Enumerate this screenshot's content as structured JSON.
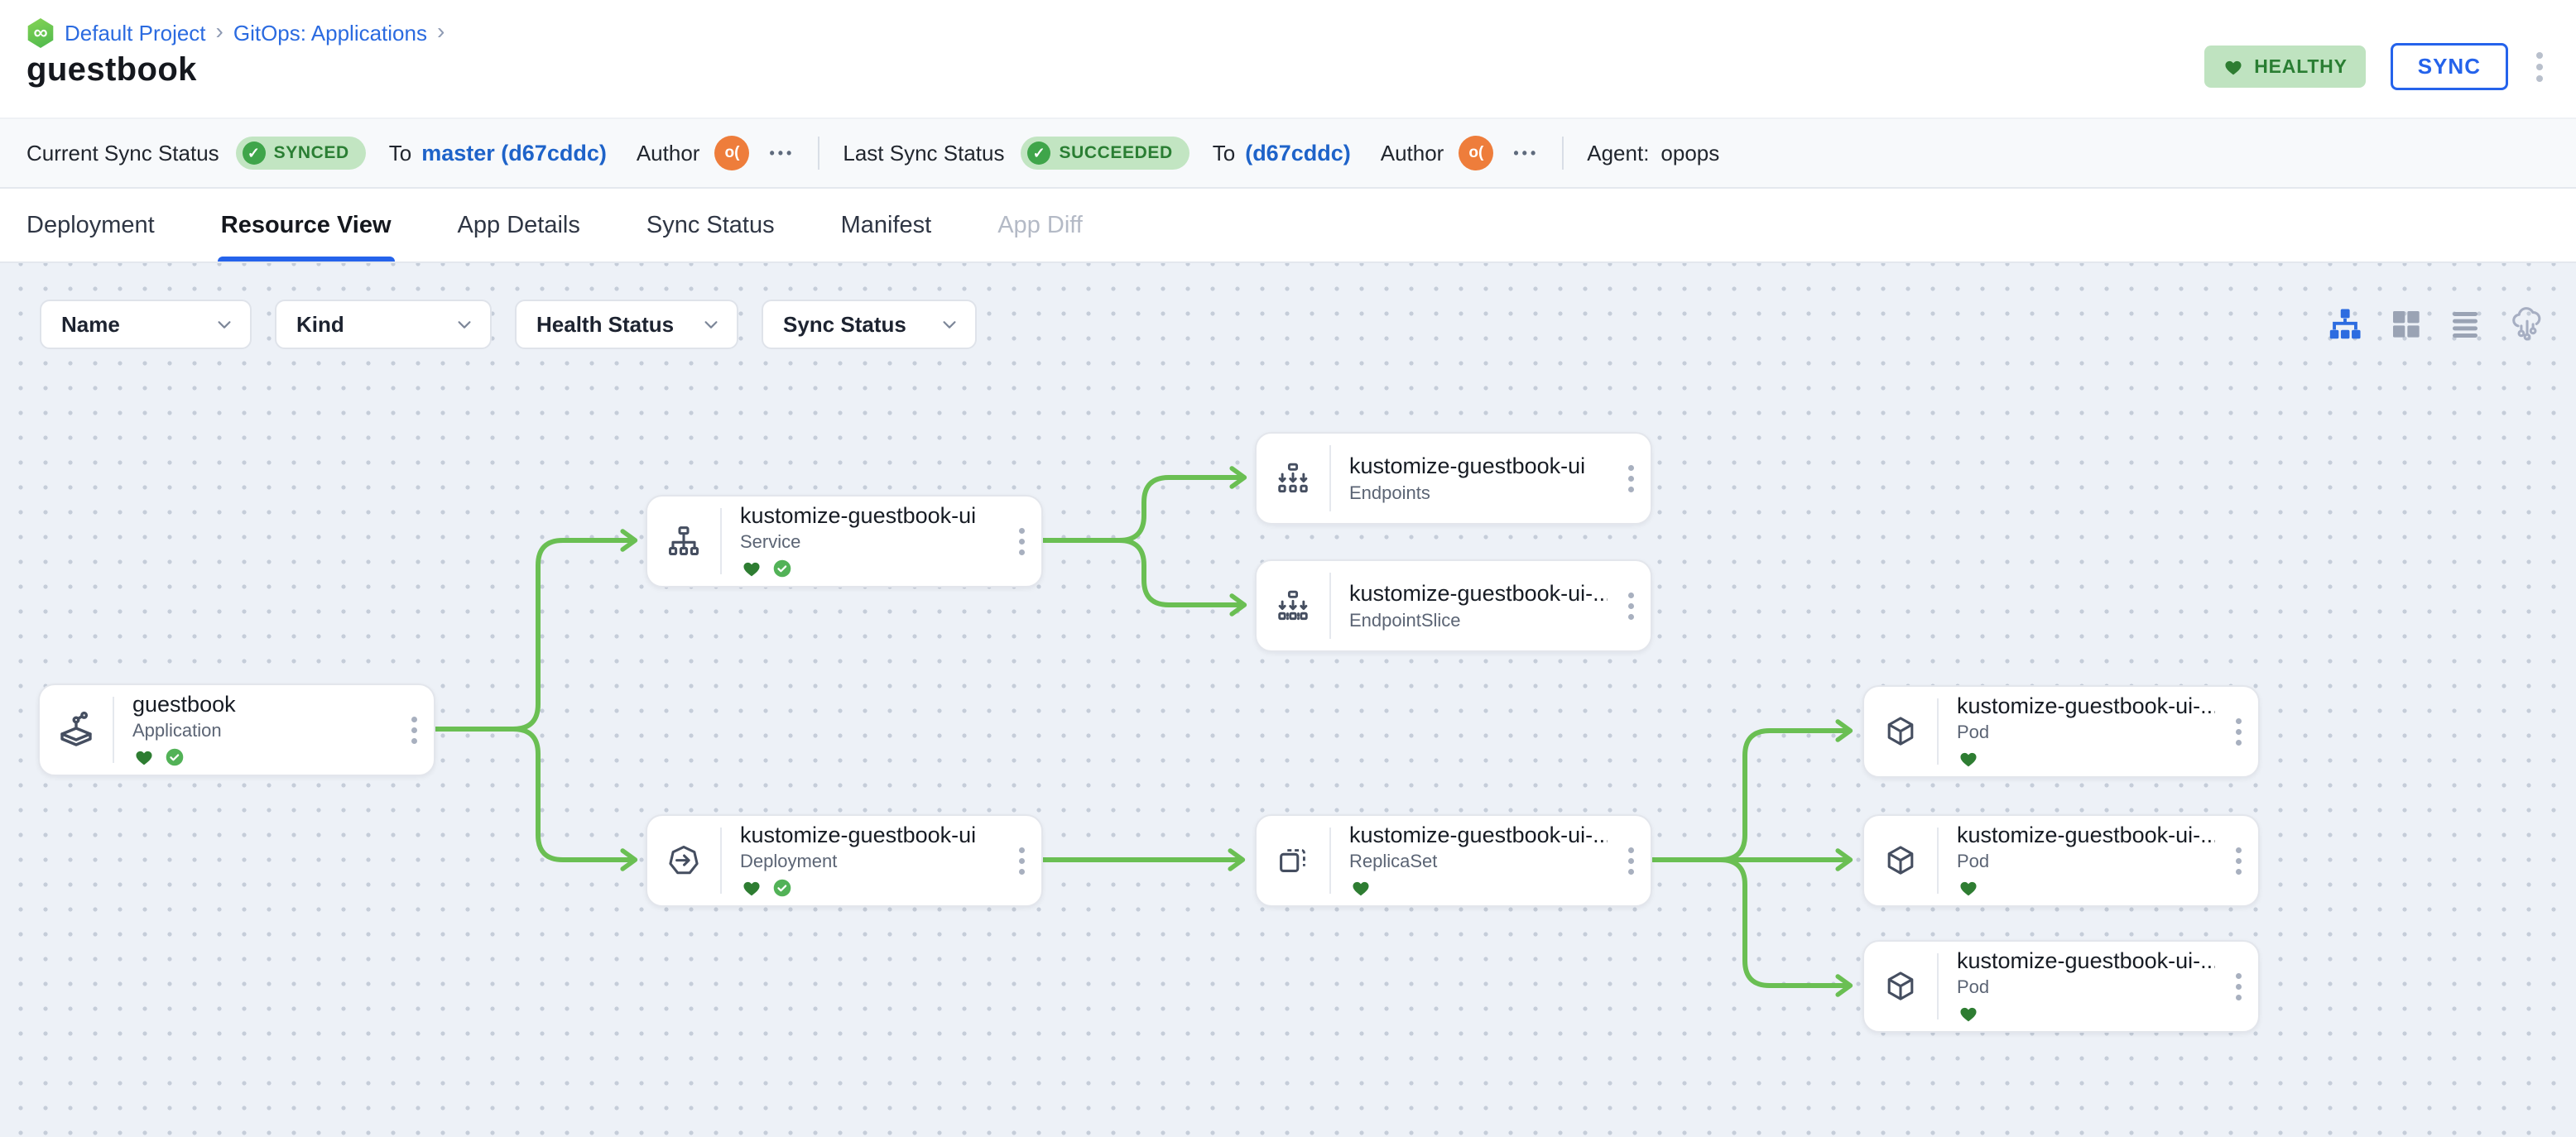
{
  "colors": {
    "accent_blue": "#2563eb",
    "link_blue": "#1e63c9",
    "edge_green": "#6abf53",
    "badge_bg": "#c2e5c2",
    "badge_text": "#2a7e33",
    "heart_green": "#2e7d32",
    "check_green": "#52b257",
    "avatar_orange": "#ee7d3b"
  },
  "header": {
    "breadcrumb": {
      "project": "Default Project",
      "section": "GitOps: Applications",
      "separator": "›"
    },
    "title": "guestbook",
    "health_badge": "HEALTHY",
    "sync_button": "SYNC"
  },
  "status_bar": {
    "current": {
      "label": "Current Sync Status",
      "badge": "SYNCED",
      "badge_check": "✓",
      "to": "To",
      "target": "master (d67cddc)",
      "author": "Author",
      "avatar": "o(",
      "more": "•••"
    },
    "last": {
      "label": "Last Sync Status",
      "badge": "SUCCEEDED",
      "badge_check": "✓",
      "to": "To",
      "target": "(d67cddc)",
      "author": "Author",
      "avatar": "o(",
      "more": "•••"
    },
    "agent_label": "Agent:",
    "agent_value": "opops"
  },
  "tabs": [
    {
      "label": "Deployment"
    },
    {
      "label": "Resource View",
      "active": true
    },
    {
      "label": "App Details"
    },
    {
      "label": "Sync Status"
    },
    {
      "label": "Manifest"
    },
    {
      "label": "App Diff",
      "disabled": true
    }
  ],
  "filters": {
    "name": "Name",
    "kind": "Kind",
    "health": "Health Status",
    "sync": "Sync Status"
  },
  "icons": {
    "view_toggles": [
      "tree-view-icon",
      "grid-view-icon",
      "list-view-icon",
      "cloud-view-icon"
    ],
    "project": "infinity-hexagon-icon"
  },
  "nodes": [
    {
      "name": "guestbook",
      "kind": "Application",
      "healthy": true,
      "synced": true
    },
    {
      "name": "kustomize-guestbook-ui",
      "kind": "Service",
      "healthy": true,
      "synced": true
    },
    {
      "name": "kustomize-guestbook-ui",
      "kind": "Endpoints"
    },
    {
      "name": "kustomize-guestbook-ui-...",
      "kind": "EndpointSlice"
    },
    {
      "name": "kustomize-guestbook-ui",
      "kind": "Deployment",
      "healthy": true,
      "synced": true
    },
    {
      "name": "kustomize-guestbook-ui-...",
      "kind": "ReplicaSet",
      "healthy": true
    },
    {
      "name": "kustomize-guestbook-ui-...",
      "kind": "Pod",
      "healthy": true
    },
    {
      "name": "kustomize-guestbook-ui-...",
      "kind": "Pod",
      "healthy": true
    },
    {
      "name": "kustomize-guestbook-ui-...",
      "kind": "Pod",
      "healthy": true
    }
  ]
}
